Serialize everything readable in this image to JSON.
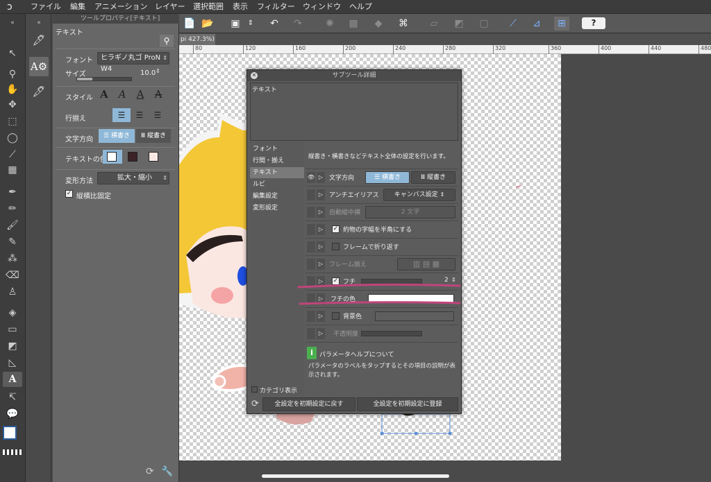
{
  "menu": [
    "ファイル",
    "編集",
    "アニメーション",
    "レイヤー",
    "選択範囲",
    "表示",
    "フィルター",
    "ウィンドウ",
    "ヘルプ"
  ],
  "toolprop": {
    "title": "ツールプロパティ[テキスト]",
    "subtool_name": "テキスト",
    "font_label": "フォント",
    "font_value": "ヒラギノ丸ゴ ProN W4",
    "size_label": "サイズ",
    "size_value": "10.0",
    "style_label": "スタイル",
    "align_label": "行揃え",
    "direction_label": "文字方向",
    "direction_horizontal": "横書き",
    "direction_vertical": "縦書き",
    "text_color_label": "テキストの色",
    "transform_label": "変形方法",
    "transform_value": "拡大・縮小",
    "keep_ratio_label": "縦横比固定"
  },
  "canvas": {
    "tab_label": "pi 427.3%)",
    "ruler_ticks": [
      "80",
      "120",
      "160",
      "200",
      "240",
      "280",
      "320",
      "360",
      "400",
      "440",
      "480"
    ]
  },
  "dialog": {
    "title": "サブツール詳細",
    "preview_text": "テキスト",
    "categories": [
      "フォント",
      "行間・揃え",
      "テキスト",
      "ルビ",
      "編集設定",
      "変形設定"
    ],
    "selected_category": "テキスト",
    "description": "縦書き・横書きなどテキスト全体の設定を行います。",
    "rows": {
      "direction_label": "文字方向",
      "direction_h": "横書き",
      "direction_v": "縦書き",
      "antialias_label": "アンチエイリアス",
      "antialias_value": "キャンバス設定",
      "auto_tcy_label": "自動縦中横",
      "auto_tcy_value": "2 文字",
      "halfwidth_label": "約物の字幅を半角にする",
      "wrap_label": "フレームで折り返す",
      "frame_align_label": "フレーム揃え",
      "edge_label": "フチ",
      "edge_value": "2",
      "edge_color_label": "フチの色",
      "bg_color_label": "背景色",
      "opacity_label": "不透明度"
    },
    "help_title": "パラメータヘルプについて",
    "help_text": "パラメータのラベルをタップするとその項目の説明が表示されます。",
    "category_show_label": "カテゴリ表示",
    "reset_button": "全設定を初期設定に戻す",
    "register_button": "全設定を初期設定に登録"
  },
  "colors": {
    "selection_blue": "#8fb8d8",
    "annotation_pink": "#c0457a",
    "edge_color": "#ffffff"
  }
}
